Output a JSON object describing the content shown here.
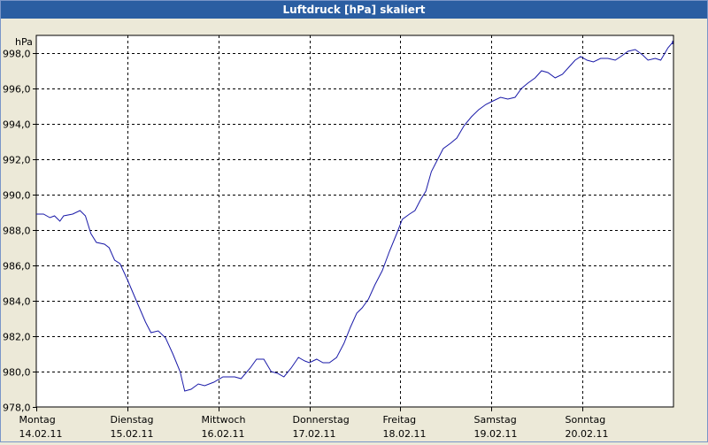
{
  "window": {
    "title": "Luftdruck [hPa] skaliert"
  },
  "colors": {
    "titlebar": "#2b5ea2",
    "line": "#1a1aa8",
    "grid": "#000000",
    "plot_bg": "#ffffff"
  },
  "chart_data": {
    "type": "line",
    "title": "Luftdruck [hPa] skaliert",
    "ylabel": "hPa",
    "xlabel": "",
    "ylim": [
      978.0,
      999.0
    ],
    "y_ticks": [
      "998,0",
      "996,0",
      "994,0",
      "992,0",
      "990,0",
      "988,0",
      "986,0",
      "984,0",
      "982,0",
      "980,0",
      "978,0"
    ],
    "y_tick_values": [
      998,
      996,
      994,
      992,
      990,
      988,
      986,
      984,
      982,
      980,
      978
    ],
    "x_day_range": [
      0,
      7
    ],
    "x_ticks": [
      {
        "day": "Montag",
        "date": "14.02.11",
        "pos": 0
      },
      {
        "day": "Dienstag",
        "date": "15.02.11",
        "pos": 1
      },
      {
        "day": "Mittwoch",
        "date": "16.02.11",
        "pos": 2
      },
      {
        "day": "Donnerstag",
        "date": "17.02.11",
        "pos": 3
      },
      {
        "day": "Freitag",
        "date": "18.02.11",
        "pos": 4
      },
      {
        "day": "Samstag",
        "date": "19.02.11",
        "pos": 5
      },
      {
        "day": "Sonntag",
        "date": "20.02.11",
        "pos": 6
      }
    ],
    "grid": true,
    "series": [
      {
        "values": [
          [
            0.0,
            988.9
          ],
          [
            0.08,
            988.9
          ],
          [
            0.15,
            988.7
          ],
          [
            0.2,
            988.8
          ],
          [
            0.26,
            988.5
          ],
          [
            0.3,
            988.8
          ],
          [
            0.4,
            988.9
          ],
          [
            0.48,
            989.1
          ],
          [
            0.54,
            988.8
          ],
          [
            0.6,
            987.8
          ],
          [
            0.66,
            987.3
          ],
          [
            0.75,
            987.2
          ],
          [
            0.8,
            987.0
          ],
          [
            0.86,
            986.3
          ],
          [
            0.92,
            986.1
          ],
          [
            1.0,
            985.2
          ],
          [
            1.1,
            984.0
          ],
          [
            1.2,
            982.8
          ],
          [
            1.26,
            982.2
          ],
          [
            1.34,
            982.3
          ],
          [
            1.42,
            981.9
          ],
          [
            1.5,
            981.0
          ],
          [
            1.58,
            980.0
          ],
          [
            1.63,
            978.9
          ],
          [
            1.7,
            979.0
          ],
          [
            1.78,
            979.3
          ],
          [
            1.85,
            979.2
          ],
          [
            1.95,
            979.4
          ],
          [
            2.05,
            979.7
          ],
          [
            2.18,
            979.7
          ],
          [
            2.25,
            979.6
          ],
          [
            2.35,
            980.2
          ],
          [
            2.42,
            980.7
          ],
          [
            2.5,
            980.7
          ],
          [
            2.58,
            980.0
          ],
          [
            2.65,
            979.9
          ],
          [
            2.72,
            979.7
          ],
          [
            2.8,
            980.2
          ],
          [
            2.88,
            980.8
          ],
          [
            2.95,
            980.6
          ],
          [
            3.0,
            980.5
          ],
          [
            3.08,
            980.7
          ],
          [
            3.15,
            980.5
          ],
          [
            3.22,
            980.5
          ],
          [
            3.3,
            980.8
          ],
          [
            3.38,
            981.6
          ],
          [
            3.45,
            982.5
          ],
          [
            3.52,
            983.3
          ],
          [
            3.58,
            983.6
          ],
          [
            3.65,
            984.1
          ],
          [
            3.72,
            984.9
          ],
          [
            3.8,
            985.7
          ],
          [
            3.88,
            986.8
          ],
          [
            3.96,
            987.8
          ],
          [
            4.02,
            988.6
          ],
          [
            4.1,
            988.9
          ],
          [
            4.16,
            989.1
          ],
          [
            4.22,
            989.7
          ],
          [
            4.28,
            990.2
          ],
          [
            4.34,
            991.3
          ],
          [
            4.4,
            991.9
          ],
          [
            4.47,
            992.6
          ],
          [
            4.55,
            992.9
          ],
          [
            4.62,
            993.2
          ],
          [
            4.7,
            993.9
          ],
          [
            4.78,
            994.4
          ],
          [
            4.86,
            994.8
          ],
          [
            4.94,
            995.1
          ],
          [
            5.02,
            995.3
          ],
          [
            5.1,
            995.5
          ],
          [
            5.18,
            995.4
          ],
          [
            5.26,
            995.5
          ],
          [
            5.33,
            996.0
          ],
          [
            5.4,
            996.3
          ],
          [
            5.48,
            996.6
          ],
          [
            5.55,
            997.0
          ],
          [
            5.62,
            996.9
          ],
          [
            5.7,
            996.6
          ],
          [
            5.78,
            996.8
          ],
          [
            5.85,
            997.2
          ],
          [
            5.92,
            997.6
          ],
          [
            5.98,
            997.8
          ],
          [
            6.05,
            997.6
          ],
          [
            6.12,
            997.5
          ],
          [
            6.2,
            997.7
          ],
          [
            6.28,
            997.7
          ],
          [
            6.36,
            997.6
          ],
          [
            6.42,
            997.8
          ],
          [
            6.5,
            998.1
          ],
          [
            6.58,
            998.2
          ],
          [
            6.66,
            997.9
          ],
          [
            6.72,
            997.6
          ],
          [
            6.8,
            997.7
          ],
          [
            6.86,
            997.6
          ],
          [
            6.94,
            998.3
          ],
          [
            7.0,
            998.6
          ],
          [
            7.08,
            998.7
          ],
          [
            7.15,
            998.5
          ]
        ]
      }
    ]
  }
}
